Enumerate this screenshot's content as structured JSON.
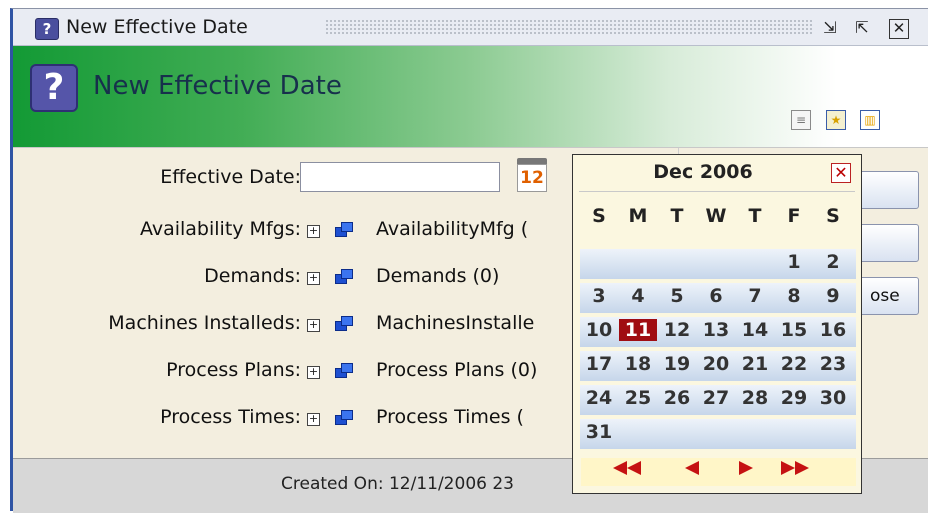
{
  "window": {
    "title": "New Effective Date"
  },
  "header": {
    "title": "New Effective Date"
  },
  "form": {
    "effective_date_label": "Effective Date:",
    "effective_date_value": "",
    "calendar_icon_text": "12",
    "fields": [
      {
        "label": "Availability Mfgs:",
        "value": "AvailabilityMfg ("
      },
      {
        "label": "Demands:",
        "value": "Demands (0)"
      },
      {
        "label": "Machines Installeds:",
        "value": "MachinesInstalle"
      },
      {
        "label": "Process Plans:",
        "value": "Process Plans (0)"
      },
      {
        "label": "Process Times:",
        "value": "Process Times ("
      }
    ]
  },
  "right_panel": {
    "button3_label": "ose"
  },
  "footer": {
    "created_on": "Created On: 12/11/2006 23"
  },
  "calendar": {
    "month": "Dec 2006",
    "close": "✕",
    "weekdays": [
      "S",
      "M",
      "T",
      "W",
      "T",
      "F",
      "S"
    ],
    "weeks": [
      [
        "",
        "",
        "",
        "",
        "",
        "1",
        "2"
      ],
      [
        "3",
        "4",
        "5",
        "6",
        "7",
        "8",
        "9"
      ],
      [
        "10",
        "11",
        "12",
        "13",
        "14",
        "15",
        "16"
      ],
      [
        "17",
        "18",
        "19",
        "20",
        "21",
        "22",
        "23"
      ],
      [
        "24",
        "25",
        "26",
        "27",
        "28",
        "29",
        "30"
      ],
      [
        "31",
        "",
        "",
        "",
        "",
        "",
        ""
      ]
    ],
    "selected_day": "11",
    "nav": [
      "previous-year-icon",
      "previous-month-icon",
      "next-month-icon",
      "next-year-icon"
    ]
  }
}
